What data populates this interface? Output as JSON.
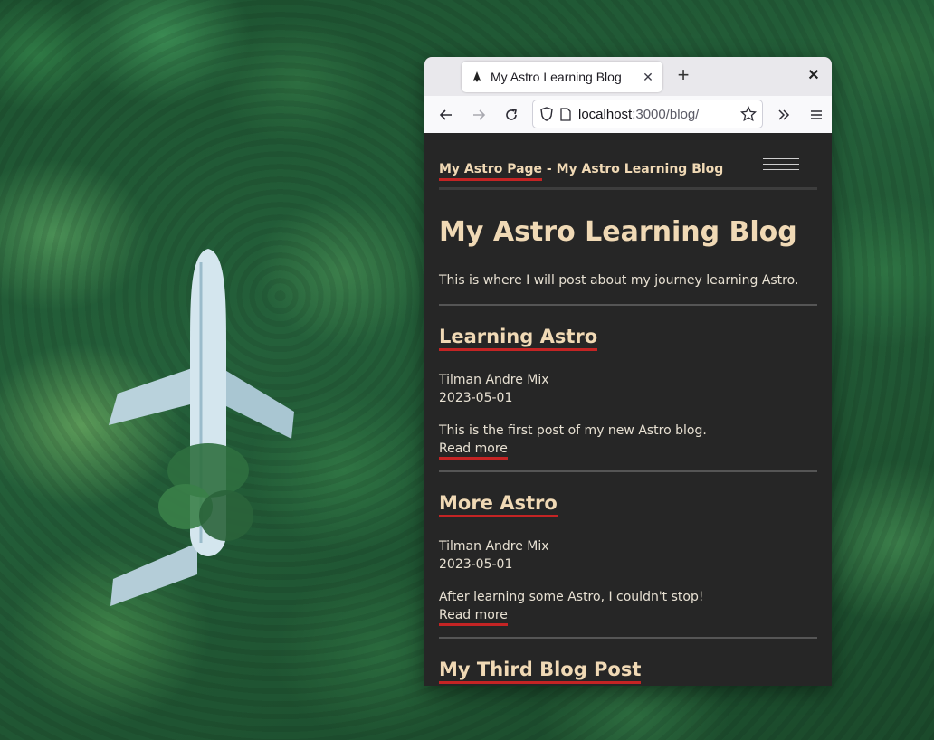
{
  "browser": {
    "tab_title": "My Astro Learning Blog",
    "url_host": "localhost",
    "url_path": ":3000/blog/"
  },
  "site": {
    "home_link": "My Astro Page",
    "title_separator": " - ",
    "title_suffix": "My Astro Learning Blog"
  },
  "blog": {
    "heading": "My Astro Learning Blog",
    "intro": "This is where I will post about my journey learning Astro.",
    "posts": [
      {
        "title": "Learning Astro",
        "author": "Tilman Andre Mix",
        "date": "2023-05-01",
        "description": "This is the first post of my new Astro blog.",
        "read_more": "Read more"
      },
      {
        "title": "More Astro",
        "author": "Tilman Andre Mix",
        "date": "2023-05-01",
        "description": "After learning some Astro, I couldn't stop!",
        "read_more": "Read more"
      },
      {
        "title": "My Third Blog Post"
      }
    ]
  },
  "colors": {
    "page_bg": "#262626",
    "heading": "#f0d9b5",
    "accent_underline": "#c42424"
  }
}
